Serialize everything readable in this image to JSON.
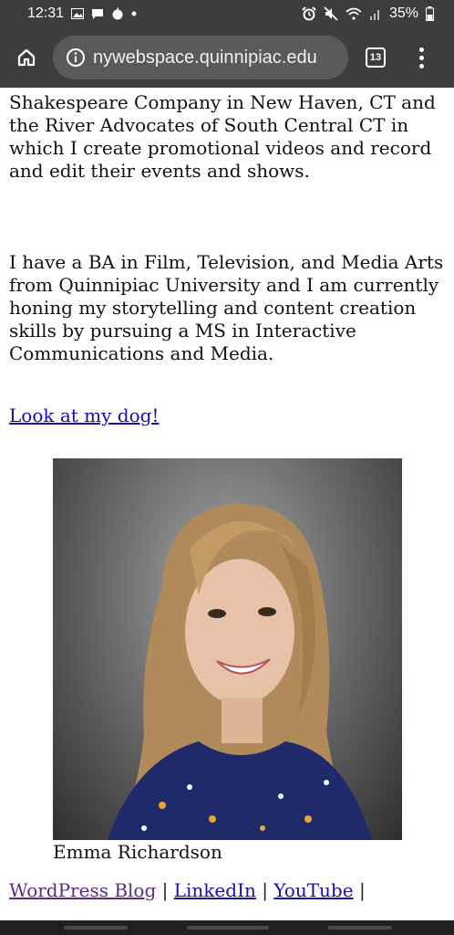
{
  "status_bar": {
    "time": "12:31",
    "battery": "35%",
    "icons_left": [
      "image-icon",
      "message-icon",
      "apple-icon",
      "dot-icon"
    ],
    "icons_right": [
      "alarm-icon",
      "mute-icon",
      "wifi-icon",
      "signal-icon",
      "battery-icon"
    ]
  },
  "browser": {
    "url": "nywebspace.quinnipiac.edu",
    "tab_count": "13"
  },
  "page": {
    "paragraph1": "Shakespeare Company in New Haven, CT and the River Advocates of South Central CT in which I create promotional videos and record and edit their events and shows.",
    "paragraph2": "I have a BA in Film, Television, and Media Arts from Quinnipiac University and I am currently honing my storytelling and content creation skills by pursuing a MS in Interactive Communications and Media.",
    "dog_link": "Look at my dog!",
    "photo_caption": "Emma Richardson",
    "footer": {
      "wordpress": "WordPress Blog",
      "linkedin": "LinkedIn",
      "youtube": "YouTube",
      "separator": "|"
    }
  },
  "colors": {
    "chrome_bg": "#3d3d3d",
    "link": "#1a0dab",
    "visited_link": "#5b2a86"
  }
}
